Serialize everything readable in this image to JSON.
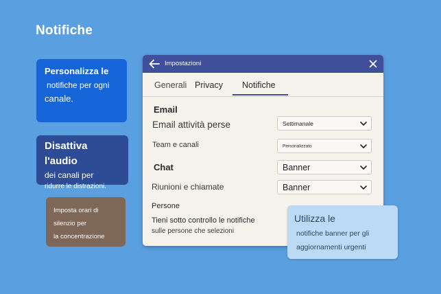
{
  "page": {
    "title": "Notifiche"
  },
  "cards": {
    "customize": {
      "line1": "Personalizza le",
      "line2": "notifiche per ogni",
      "line3": "canale."
    },
    "mute": {
      "line1": "Disattiva l'audio",
      "line2": "dei canali per",
      "line3": "ridurre le distrazioni."
    },
    "quiet_hours": {
      "line1": "Imposta orari di",
      "line2": "silenzio per",
      "line3": "la concentrazione"
    },
    "banner_tip": {
      "line1": "Utilizza le",
      "line2": "notifiche banner per gli",
      "line3": "aggiornamenti urgenti"
    }
  },
  "dialog": {
    "title": "Impostazioni",
    "tabs": [
      {
        "label": "Generali",
        "active": false
      },
      {
        "label": "Privacy",
        "active": false
      },
      {
        "label": "Notifiche",
        "active": true
      }
    ],
    "sections": {
      "email": {
        "heading": "Email",
        "missed_activity": {
          "label": "Email attività perse",
          "value": "Settimanale"
        },
        "teams_channels": {
          "label": "Team e canali",
          "value": "Personalizzato"
        }
      },
      "chat": {
        "heading": "Chat",
        "value": "Banner",
        "meetings_calls": {
          "label": "Riunioni e chiamate",
          "value": "Banner"
        }
      },
      "people": {
        "heading": "Persone",
        "desc_line1": "Tieni sotto controllo le notifiche",
        "desc_line2": "sulle persone che selezioni"
      }
    }
  },
  "colors": {
    "background": "#5a9fe0",
    "titlebar": "#3f4f9c",
    "card_customize": "#1565d8",
    "card_mute": "#2e4c95",
    "card_quiet_hours": "#7f6757",
    "card_banner_tip": "#bcd9f6"
  },
  "icons": {
    "back": "arrow-left-icon",
    "close": "close-icon",
    "dropdown": "chevron-down-icon"
  }
}
